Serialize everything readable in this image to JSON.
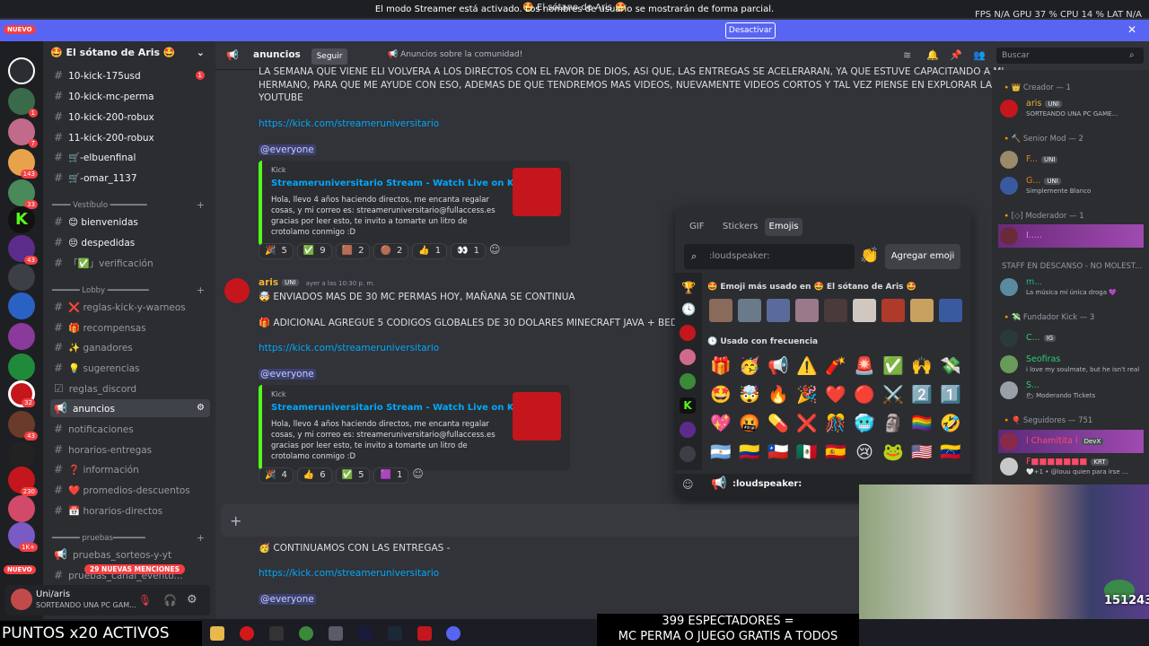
{
  "window": {
    "title": "🤩 El sótano de Aris 🤩",
    "stats": "FPS N/A   GPU 37 %   CPU 14 %   LAT N/A"
  },
  "banner": {
    "text": "El modo Streamer está activado. Los nombres de usuario se mostrarán de forma parcial.",
    "button": "Desactivar"
  },
  "rail": {
    "new_top": "NUEVO",
    "new_bottom": "NUEVO",
    "badges": [
      "1",
      "7",
      "143",
      "33",
      "43",
      "32",
      "43",
      "230",
      "1K+"
    ]
  },
  "server": {
    "name": "🤩 El sótano de Aris 🤩"
  },
  "channels": [
    {
      "name": "10-kick-175usd",
      "badge": "1"
    },
    {
      "name": "10-kick-mc-perma"
    },
    {
      "name": "10-kick-200-robux"
    },
    {
      "name": "11-kick-200-robux"
    },
    {
      "name": "🛒-elbuenfinal"
    },
    {
      "name": "🛒-omar_1137"
    }
  ],
  "categories": {
    "vestibulo": "━━━━ Vestíbulo ━━━━━━━━",
    "lobby": "━━━━━━ Lobby ━━━━━━━━━",
    "pruebas": "━━━━━━ pruebas━━━━━━━"
  },
  "vestibulo_channels": [
    "😊 bienvenidas",
    "😔 despedidas",
    "「✅」verificación"
  ],
  "lobby_channels": [
    "❌ reglas-kick-y-warneos",
    "🎁 recompensas",
    "✨ ganadores",
    "💡 sugerencias",
    "reglas_discord",
    "anuncios",
    "notificaciones",
    "horarios-entregas",
    "❓ información",
    "❤️ promedios-descuentos",
    "📅 horarios-directos"
  ],
  "pruebas_channels": [
    "pruebas_sorteos-y-yt",
    "pruebas_canal_evento..."
  ],
  "mentions_pill": "29 NUEVAS MENCIONES",
  "user": {
    "name": "Uni/aris",
    "status": "SORTEANDO UNA PC GAM..."
  },
  "header": {
    "channel": "anuncios",
    "follow": "Seguir",
    "topic": "📢 Anuncios sobre la comunidad!",
    "search": "Buscar"
  },
  "messages": {
    "m1_line1": "LA SEMANA QUE VIENE ELI VOLVERA A LOS DIRECTOS CON EL FAVOR DE DIOS, ASI QUE, LAS ENTREGAS SE ACELERARAN, YA QUE ESTUVE CAPACITANDO A MI",
    "m1_line2": "HERMANO, PARA QUE ME AYUDE CON ESO, ADEMAS DE QUE TENDREMOS MAS VIDEOS, NUEVAMENTE VIDEOS CORTOS Y TAL VEZ PIENSE EN EXPLORAR LA OPCION DE",
    "m1_line3": "YOUTUBE",
    "link": "https://kick.com/streameruniversitario",
    "everyone": "@everyone",
    "embed_provider": "Kick",
    "embed_title": "Streameruniversitario Stream - Watch Live on Kick",
    "embed_desc": "Hola, llevo 4 años haciendo directos, me encanta regalar cosas, y mi correo es: streameruniversitario@fullaccess.es gracias por leer esto, te invito a tomarte un litro de crotolamo conmigo :D",
    "author": "aris",
    "author_tag": "UNI",
    "timestamp": "ayer a las 10:30 p. m.",
    "m2_line1": "🤯 ENVIADOS MAS DE 30 MC PERMAS HOY, MAÑANA SE CONTINUA",
    "m2_line2": "🎁 ADICIONAL AGREGUE 5 CODIGOS GLOBALES DE 30 DOLARES MINECRAFT JAVA + BEDROCK EN",
    "m3_line1": "🥳 CONTINUAMOS CON LAS ENTREGAS -"
  },
  "reactions1": [
    {
      "e": "🎉",
      "n": "5"
    },
    {
      "e": "✅",
      "n": "9"
    },
    {
      "e": "🟫",
      "n": "2"
    },
    {
      "e": "🟤",
      "n": "2"
    },
    {
      "e": "👍",
      "n": "1"
    },
    {
      "e": "👀",
      "n": "1"
    }
  ],
  "reactions2": [
    {
      "e": "🎉",
      "n": "4"
    },
    {
      "e": "👍",
      "n": "6"
    },
    {
      "e": "✅",
      "n": "5"
    },
    {
      "e": "🟪",
      "n": "1"
    }
  ],
  "picker": {
    "tabs": [
      "GIF",
      "Stickers",
      "Emojis"
    ],
    "search_placeholder": ":loudspeaker:",
    "add": "Agregar emoji",
    "most_used": "🤩 Emoji más usado en 🤩 El sótano de Aris 🤩",
    "frequent": "🕓 Usado con frecuencia",
    "footer": ":loudspeaker:",
    "freq_emojis": [
      "🎁",
      "🥳",
      "📢",
      "⚠️",
      "🧨",
      "🚨",
      "✅",
      "🙌",
      "💸",
      "🤩",
      "🤯",
      "🔥",
      "🎉",
      "❤️",
      "🔴",
      "⚔️",
      "2️⃣",
      "1️⃣",
      "💖",
      "🤬",
      "💊",
      "❌",
      "🎊",
      "🥶",
      "🗿",
      "🏳️‍🌈",
      "🤣",
      "🇦🇷",
      "🇨🇴",
      "🇨🇱",
      "🇲🇽",
      "🇪🇸",
      "😢",
      "🐸",
      "🇺🇸",
      "🇻🇪"
    ]
  },
  "members": {
    "creator_cat": "🔸👑 Creador — 1",
    "creator": {
      "name": "aris",
      "tag": "UNI",
      "status": "SORTEANDO UNA PC GAME..."
    },
    "senior_cat": "🔸🔨 Senior Mod — 2",
    "senior": [
      {
        "name": "F...",
        "tag": "UNI",
        "status": ""
      },
      {
        "name": "G...",
        "tag": "UNI",
        "status": "Simplemente Blanco"
      }
    ],
    "mod_cat": "🔸[◇] Moderador — 1",
    "mod": [
      {
        "name": "I.....",
        "status": ""
      }
    ],
    "staff_cat": "STAFF EN DESCANSO - NO MOLEST...",
    "staff": [
      {
        "name": "m...",
        "status": "La música mi única droga 💜"
      }
    ],
    "founder_cat": "🔸💸 Fundador Kick — 3",
    "founder": [
      {
        "name": "C...",
        "tag": "IG",
        "status": ""
      },
      {
        "name": "Seofiras",
        "status": "i love my soulmate, but he isn't real"
      },
      {
        "name": "S...",
        "status": "🌥 Moderando Tickets"
      }
    ],
    "followers_cat": "🔸🎈 Seguidores — 751",
    "followers": [
      {
        "name": "l Chamitita l",
        "tag": "DevX",
        "status": ""
      },
      {
        "name": "F■■■■■■■",
        "tag": "KRT",
        "status": "🤍+1 • @louu quien para irse ..."
      }
    ]
  },
  "stream": {
    "puntos": "PUNTOS x20 ACTIVOS",
    "spec1": "399 ESPECTADORES =",
    "spec2": "MC PERMA O JUEGO GRATIS A TODOS",
    "count": "151243"
  },
  "colors": {
    "accent": "#5865f2",
    "kick_green": "#53fc18",
    "mention_red": "#f23f43",
    "link": "#00a8fc"
  }
}
